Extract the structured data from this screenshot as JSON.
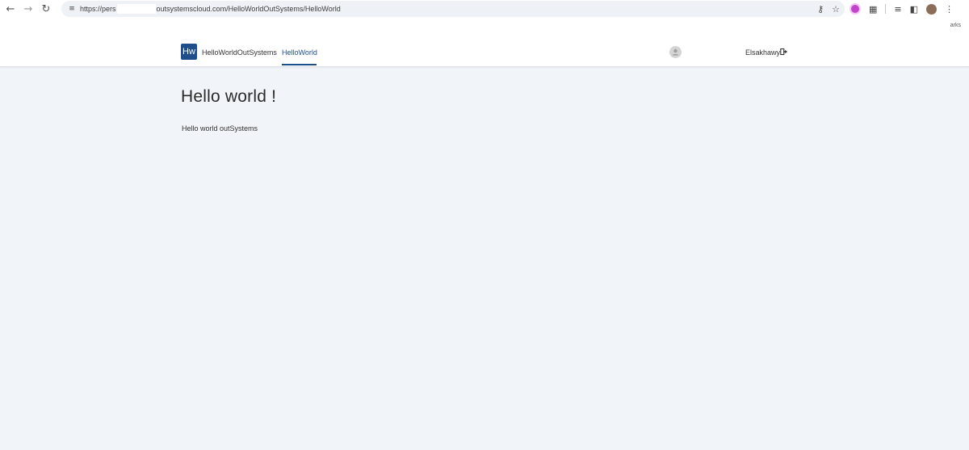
{
  "browser": {
    "url_prefix": "https://pers",
    "url_suffix": "outsystemscloud.com/HelloWorldOutSystems/HelloWorld",
    "bookmarks_label": "arks"
  },
  "header": {
    "logo_text": "Hw",
    "app_name": "HelloWorldOutSystems",
    "nav_item": "HelloWorld",
    "username": "Elsakhawy"
  },
  "main": {
    "title": "Hello world !",
    "text": "Hello world outSystems"
  },
  "colors": {
    "brand": "#1f4e8c",
    "background": "#f1f4f8",
    "header_bg": "#ffffff"
  },
  "icons": {
    "back": "back-arrow-icon",
    "forward": "forward-arrow-icon",
    "reload": "reload-icon",
    "site_settings": "tune-icon",
    "password": "key-icon",
    "bookmark": "star-icon",
    "extension": "puzzle-icon",
    "reading_list": "reading-list-icon",
    "side_panel": "side-panel-icon",
    "menu": "kebab-menu-icon",
    "logout": "logout-icon",
    "avatar": "user-avatar-icon"
  }
}
